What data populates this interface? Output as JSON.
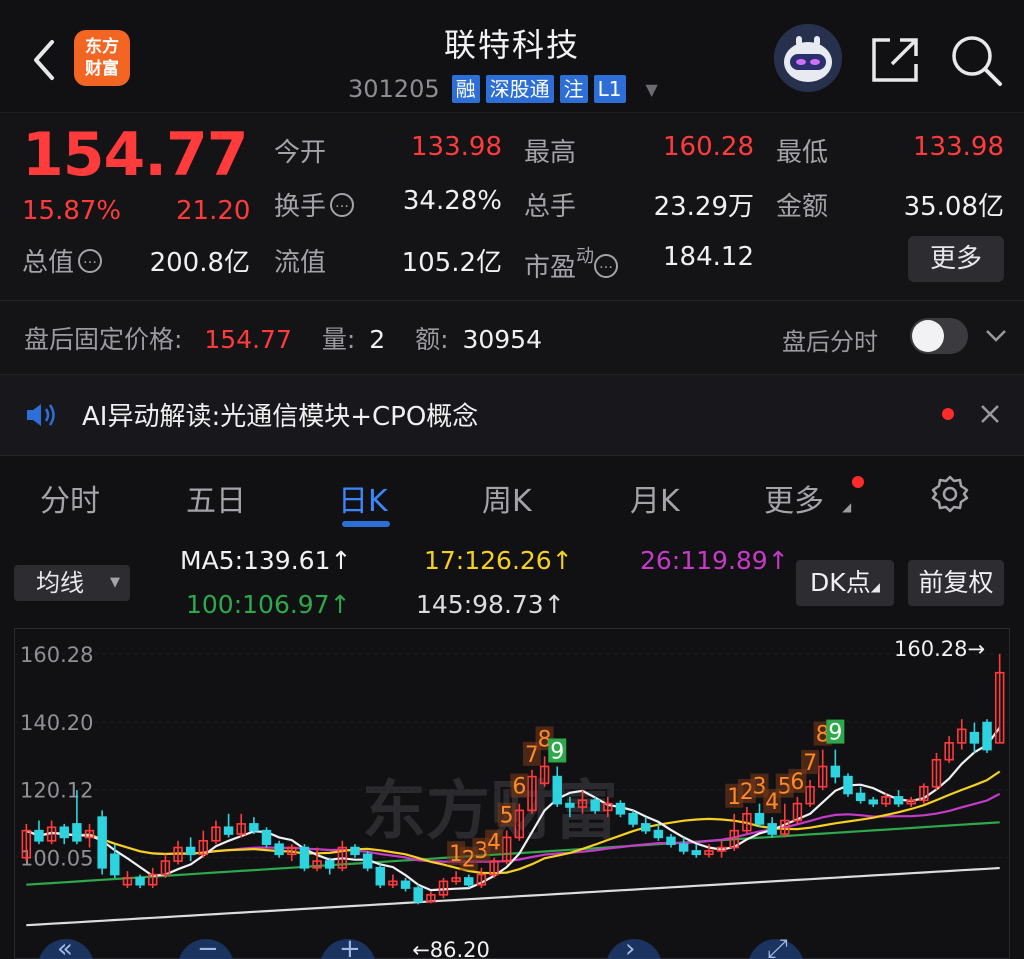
{
  "header": {
    "title": "联特科技",
    "code": "301205",
    "tags": [
      "融",
      "深股通",
      "注",
      "L1"
    ],
    "logo_text": "东方\n财富",
    "icons": [
      "back-icon",
      "share-icon",
      "search-icon"
    ]
  },
  "quote": {
    "price": "154.77",
    "change_pct": "15.87%",
    "change": "21.20",
    "stats": [
      {
        "label": "今开",
        "value": "133.98",
        "color": "red"
      },
      {
        "label": "最高",
        "value": "160.28",
        "color": "red"
      },
      {
        "label": "最低",
        "value": "133.98",
        "color": "red"
      },
      {
        "label": "换手",
        "value": "34.28%",
        "color": "white",
        "info": true
      },
      {
        "label": "总手",
        "value": "23.29万",
        "color": "white"
      },
      {
        "label": "金额",
        "value": "35.08亿",
        "color": "white"
      },
      {
        "label": "总值",
        "value": "200.8亿",
        "color": "white",
        "info": true
      },
      {
        "label": "流值",
        "value": "105.2亿",
        "color": "white"
      },
      {
        "label": "市盈",
        "sup": "动",
        "value": "184.12",
        "color": "white",
        "info": true
      }
    ],
    "more_label": "更多"
  },
  "after_hours": {
    "label": "盘后固定价格:",
    "price": "154.77",
    "vol_label": "量:",
    "vol": "2",
    "amt_label": "额:",
    "amt": "30954",
    "switch_label": "盘后分时",
    "switch_on": false
  },
  "ai": {
    "text": "AI异动解读:光通信模块+CPO概念"
  },
  "tabs": [
    {
      "label": "分时",
      "active": false
    },
    {
      "label": "五日",
      "active": false
    },
    {
      "label": "日K",
      "active": true
    },
    {
      "label": "周K",
      "active": false
    },
    {
      "label": "月K",
      "active": false
    },
    {
      "label": "更多",
      "active": false
    }
  ],
  "ma_bar": {
    "selector": "均线",
    "items": [
      {
        "text": "MA5:139.61↑",
        "color": "#f0f0f2"
      },
      {
        "text": "17:126.26↑",
        "color": "#f5d020"
      },
      {
        "text": "26:119.89↑",
        "color": "#c73ac9"
      },
      {
        "text": "100:106.97↑",
        "color": "#2ea84a"
      },
      {
        "text": "145:98.73↑",
        "color": "#dcdce0"
      }
    ],
    "dk_label": "DK点",
    "adjust_label": "前复权"
  },
  "chart_data": {
    "type": "candlestick",
    "y_labels": [
      "160.28",
      "140.20",
      "120.12",
      "100.05"
    ],
    "ylim": [
      86.2,
      160.28
    ],
    "high_label": "160.28→",
    "low_label": "←86.20",
    "watermark": "东方财富",
    "up_color": "#ff3b3b",
    "down_color": "#2ed3e0",
    "candles": [
      {
        "o": 100,
        "c": 108,
        "h": 110,
        "l": 99
      },
      {
        "o": 108,
        "c": 105,
        "h": 111,
        "l": 104
      },
      {
        "o": 105,
        "c": 109,
        "h": 111,
        "l": 104
      },
      {
        "o": 109,
        "c": 106,
        "h": 110,
        "l": 104
      },
      {
        "o": 110,
        "c": 105,
        "h": 120,
        "l": 104
      },
      {
        "o": 106,
        "c": 108,
        "h": 110,
        "l": 103
      },
      {
        "o": 112,
        "c": 97,
        "h": 114,
        "l": 95
      },
      {
        "o": 101,
        "c": 95,
        "h": 104,
        "l": 94
      },
      {
        "o": 92,
        "c": 94,
        "h": 96,
        "l": 91
      },
      {
        "o": 94,
        "c": 92,
        "h": 95,
        "l": 91
      },
      {
        "o": 92,
        "c": 95,
        "h": 97,
        "l": 91
      },
      {
        "o": 95,
        "c": 99,
        "h": 101,
        "l": 94
      },
      {
        "o": 99,
        "c": 103,
        "h": 105,
        "l": 98
      },
      {
        "o": 103,
        "c": 101,
        "h": 106,
        "l": 99
      },
      {
        "o": 101,
        "c": 105,
        "h": 108,
        "l": 100
      },
      {
        "o": 105,
        "c": 109,
        "h": 111,
        "l": 104
      },
      {
        "o": 109,
        "c": 107,
        "h": 113,
        "l": 106
      },
      {
        "o": 107,
        "c": 110,
        "h": 113,
        "l": 106
      },
      {
        "o": 110,
        "c": 108,
        "h": 112,
        "l": 107
      },
      {
        "o": 108,
        "c": 104,
        "h": 109,
        "l": 103
      },
      {
        "o": 104,
        "c": 101,
        "h": 105,
        "l": 100
      },
      {
        "o": 101,
        "c": 103,
        "h": 104,
        "l": 99
      },
      {
        "o": 103,
        "c": 97,
        "h": 104,
        "l": 96
      },
      {
        "o": 97,
        "c": 99,
        "h": 103,
        "l": 96
      },
      {
        "o": 99,
        "c": 97,
        "h": 100,
        "l": 95
      },
      {
        "o": 97,
        "c": 103,
        "h": 105,
        "l": 96
      },
      {
        "o": 103,
        "c": 101,
        "h": 104,
        "l": 100
      },
      {
        "o": 101,
        "c": 97,
        "h": 102,
        "l": 96
      },
      {
        "o": 97,
        "c": 92,
        "h": 98,
        "l": 91
      },
      {
        "o": 92,
        "c": 93,
        "h": 95,
        "l": 91
      },
      {
        "o": 93,
        "c": 91,
        "h": 94,
        "l": 90
      },
      {
        "o": 91,
        "c": 87,
        "h": 92,
        "l": 86.2
      },
      {
        "o": 87,
        "c": 89,
        "h": 90,
        "l": 86.5
      },
      {
        "o": 89,
        "c": 93,
        "h": 94,
        "l": 88
      },
      {
        "o": 93,
        "c": 94,
        "h": 96,
        "l": 92
      },
      {
        "o": 94,
        "c": 92,
        "h": 95,
        "l": 91
      },
      {
        "o": 92,
        "c": 95,
        "h": 97,
        "l": 91
      },
      {
        "o": 95,
        "c": 99,
        "h": 100,
        "l": 94
      },
      {
        "o": 99,
        "c": 106,
        "h": 108,
        "l": 98
      },
      {
        "o": 106,
        "c": 114,
        "h": 116,
        "l": 105
      },
      {
        "o": 114,
        "c": 124,
        "h": 126,
        "l": 113
      },
      {
        "o": 122,
        "c": 127,
        "h": 130,
        "l": 121
      },
      {
        "o": 124,
        "c": 116,
        "h": 127,
        "l": 115
      },
      {
        "o": 116,
        "c": 115,
        "h": 118,
        "l": 112
      },
      {
        "o": 115,
        "c": 117,
        "h": 120,
        "l": 113
      },
      {
        "o": 117,
        "c": 114,
        "h": 118,
        "l": 113
      },
      {
        "o": 114,
        "c": 116,
        "h": 118,
        "l": 112
      },
      {
        "o": 116,
        "c": 113,
        "h": 117,
        "l": 112
      },
      {
        "o": 113,
        "c": 110,
        "h": 114,
        "l": 109
      },
      {
        "o": 110,
        "c": 108,
        "h": 112,
        "l": 107
      },
      {
        "o": 108,
        "c": 106,
        "h": 110,
        "l": 105
      },
      {
        "o": 106,
        "c": 104,
        "h": 107,
        "l": 103
      },
      {
        "o": 104,
        "c": 102,
        "h": 106,
        "l": 101
      },
      {
        "o": 102,
        "c": 101,
        "h": 104,
        "l": 100
      },
      {
        "o": 101,
        "c": 102,
        "h": 104,
        "l": 100
      },
      {
        "o": 102,
        "c": 103,
        "h": 105,
        "l": 100
      },
      {
        "o": 103,
        "c": 108,
        "h": 113,
        "l": 102
      },
      {
        "o": 108,
        "c": 113,
        "h": 115,
        "l": 107
      },
      {
        "o": 113,
        "c": 110,
        "h": 116,
        "l": 109
      },
      {
        "o": 110,
        "c": 107,
        "h": 112,
        "l": 106
      },
      {
        "o": 107,
        "c": 111,
        "h": 116,
        "l": 106
      },
      {
        "o": 111,
        "c": 116,
        "h": 118,
        "l": 110
      },
      {
        "o": 116,
        "c": 121,
        "h": 123,
        "l": 115
      },
      {
        "o": 121,
        "c": 127,
        "h": 132,
        "l": 120
      },
      {
        "o": 127,
        "c": 124,
        "h": 132,
        "l": 122
      },
      {
        "o": 124,
        "c": 119,
        "h": 125,
        "l": 118
      },
      {
        "o": 119,
        "c": 117,
        "h": 121,
        "l": 116
      },
      {
        "o": 117,
        "c": 116,
        "h": 118,
        "l": 115
      },
      {
        "o": 116,
        "c": 118,
        "h": 119,
        "l": 115
      },
      {
        "o": 118,
        "c": 116,
        "h": 120,
        "l": 115
      },
      {
        "o": 116,
        "c": 117,
        "h": 118,
        "l": 115
      },
      {
        "o": 117,
        "c": 121,
        "h": 122,
        "l": 116
      },
      {
        "o": 121,
        "c": 129,
        "h": 131,
        "l": 120
      },
      {
        "o": 129,
        "c": 134,
        "h": 136,
        "l": 128
      },
      {
        "o": 134,
        "c": 138,
        "h": 141,
        "l": 132
      },
      {
        "o": 137,
        "c": 134,
        "h": 140,
        "l": 131
      },
      {
        "o": 140,
        "c": 132,
        "h": 141,
        "l": 131
      },
      {
        "o": 134,
        "c": 154.77,
        "h": 160.28,
        "l": 133.98
      }
    ],
    "td_labels": [
      {
        "i": 40,
        "t": "7"
      },
      {
        "i": 41,
        "t": "8"
      },
      {
        "i": 42,
        "t": "9",
        "green": true
      },
      {
        "i": 39,
        "t": "6"
      },
      {
        "i": 38,
        "t": "5"
      },
      {
        "i": 34,
        "t": "1"
      },
      {
        "i": 35,
        "t": "2"
      },
      {
        "i": 36,
        "t": "3"
      },
      {
        "i": 37,
        "t": "4"
      },
      {
        "i": 56,
        "t": "1"
      },
      {
        "i": 57,
        "t": "2"
      },
      {
        "i": 58,
        "t": "3"
      },
      {
        "i": 59,
        "t": "4"
      },
      {
        "i": 60,
        "t": "5"
      },
      {
        "i": 61,
        "t": "6"
      },
      {
        "i": 62,
        "t": "7"
      },
      {
        "i": 63,
        "t": "8"
      },
      {
        "i": 64,
        "t": "9",
        "green": true
      }
    ],
    "overlay_controls": [
      "rewind-icon",
      "zoom-out-icon",
      "zoom-in-icon",
      "forward-icon",
      "fullscreen-icon"
    ]
  }
}
